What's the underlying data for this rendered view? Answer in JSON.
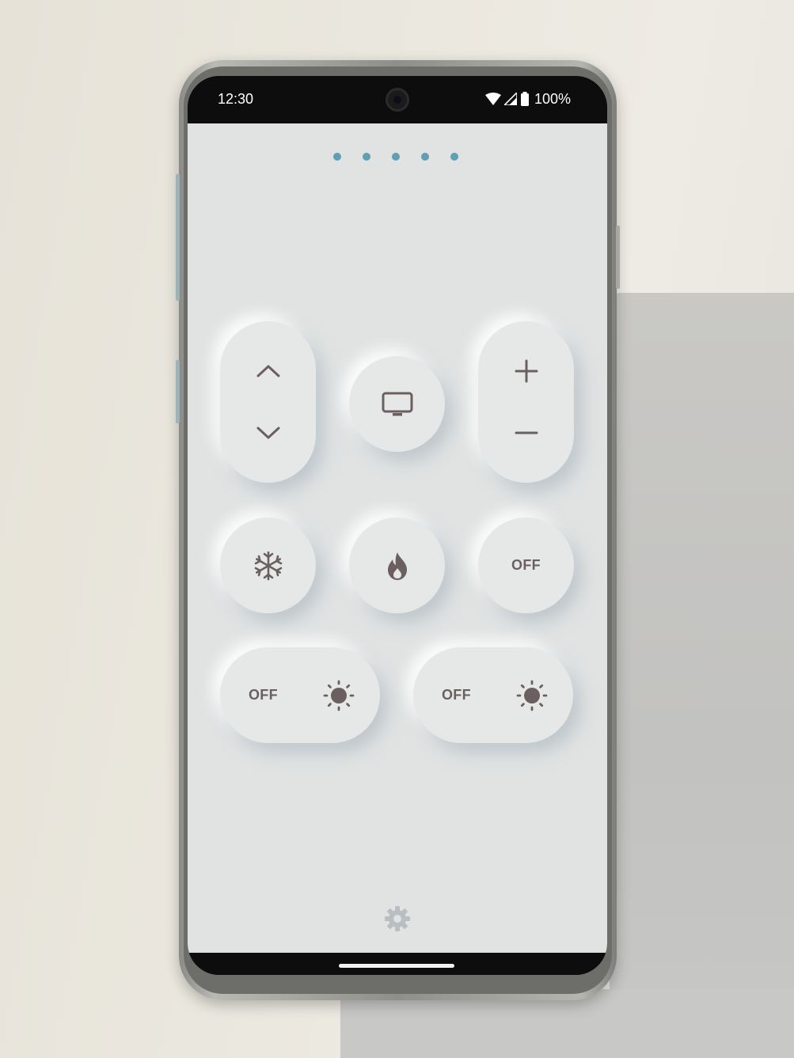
{
  "statusbar": {
    "time": "12:30",
    "battery": "100%",
    "icons": [
      "wifi-icon",
      "cell-signal-icon",
      "battery-icon"
    ]
  },
  "pager": {
    "pages": 5,
    "dot_color": "#5e9fb3"
  },
  "remote": {
    "channel": {
      "up_icon": "chevron-up-icon",
      "down_icon": "chevron-down-icon"
    },
    "tv_icon": "tv-icon",
    "volume": {
      "plus_icon": "plus-icon",
      "minus_icon": "minus-icon"
    },
    "modes": {
      "cool_icon": "snowflake-icon",
      "heat_icon": "flame-icon",
      "off_label": "OFF"
    },
    "light_1": {
      "off_label": "OFF",
      "icon": "sun-icon"
    },
    "light_2": {
      "off_label": "OFF",
      "icon": "sun-icon"
    }
  },
  "settings_icon": "gear-icon",
  "colors": {
    "background": "#e1e3e3",
    "icon": "#6b5f5f",
    "settings": "#b8bec1"
  }
}
